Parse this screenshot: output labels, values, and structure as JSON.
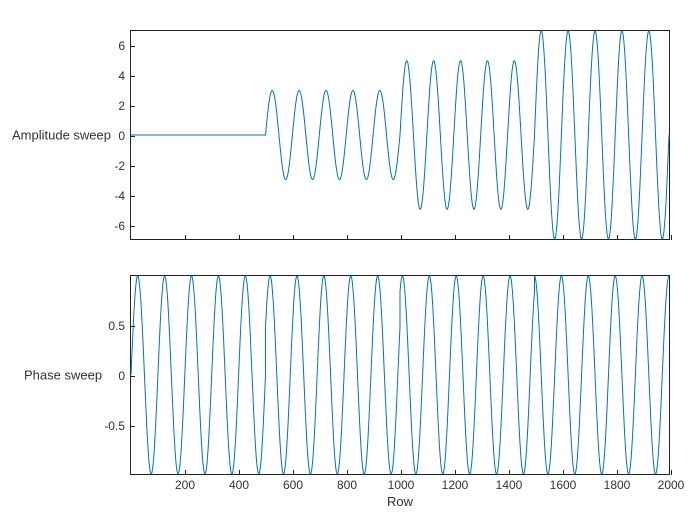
{
  "colors": {
    "line": "#0072BD",
    "axis": "#222222"
  },
  "chart_data": [
    {
      "type": "line",
      "ylabel": "Amplitude sweep",
      "xlabel": "",
      "xlim": [
        0,
        2000
      ],
      "ylim": [
        -7,
        7
      ],
      "xticks": [
        200,
        400,
        600,
        800,
        1000,
        1200,
        1400,
        1600,
        1800,
        2000
      ],
      "yticks": [
        -6,
        -4,
        -2,
        0,
        2,
        4,
        6
      ],
      "segments": [
        {
          "x_start": 0,
          "x_end": 500,
          "amplitude": 0,
          "period": 100,
          "phase_frac": 0.0
        },
        {
          "x_start": 500,
          "x_end": 1000,
          "amplitude": 3,
          "period": 100,
          "phase_frac": 0.0
        },
        {
          "x_start": 1000,
          "x_end": 1500,
          "amplitude": 5,
          "period": 100,
          "phase_frac": 0.0
        },
        {
          "x_start": 1500,
          "x_end": 2000,
          "amplitude": 7,
          "period": 100,
          "phase_frac": 0.0
        }
      ]
    },
    {
      "type": "line",
      "ylabel": "Phase sweep",
      "xlabel": "Row",
      "xlim": [
        0,
        2000
      ],
      "ylim": [
        -1,
        1
      ],
      "xticks": [
        200,
        400,
        600,
        800,
        1000,
        1200,
        1400,
        1600,
        1800,
        2000
      ],
      "yticks": [
        -0.5,
        0,
        0.5
      ],
      "segments": [
        {
          "x_start": 0,
          "x_end": 500,
          "amplitude": 1,
          "period": 100,
          "phase_frac": 0.0
        },
        {
          "x_start": 500,
          "x_end": 1000,
          "amplitude": 1,
          "period": 100,
          "phase_frac": 0.08
        },
        {
          "x_start": 1000,
          "x_end": 1500,
          "amplitude": 1,
          "period": 100,
          "phase_frac": 0.16
        },
        {
          "x_start": 1500,
          "x_end": 2000,
          "amplitude": 1,
          "period": 100,
          "phase_frac": 0.25
        }
      ]
    }
  ]
}
